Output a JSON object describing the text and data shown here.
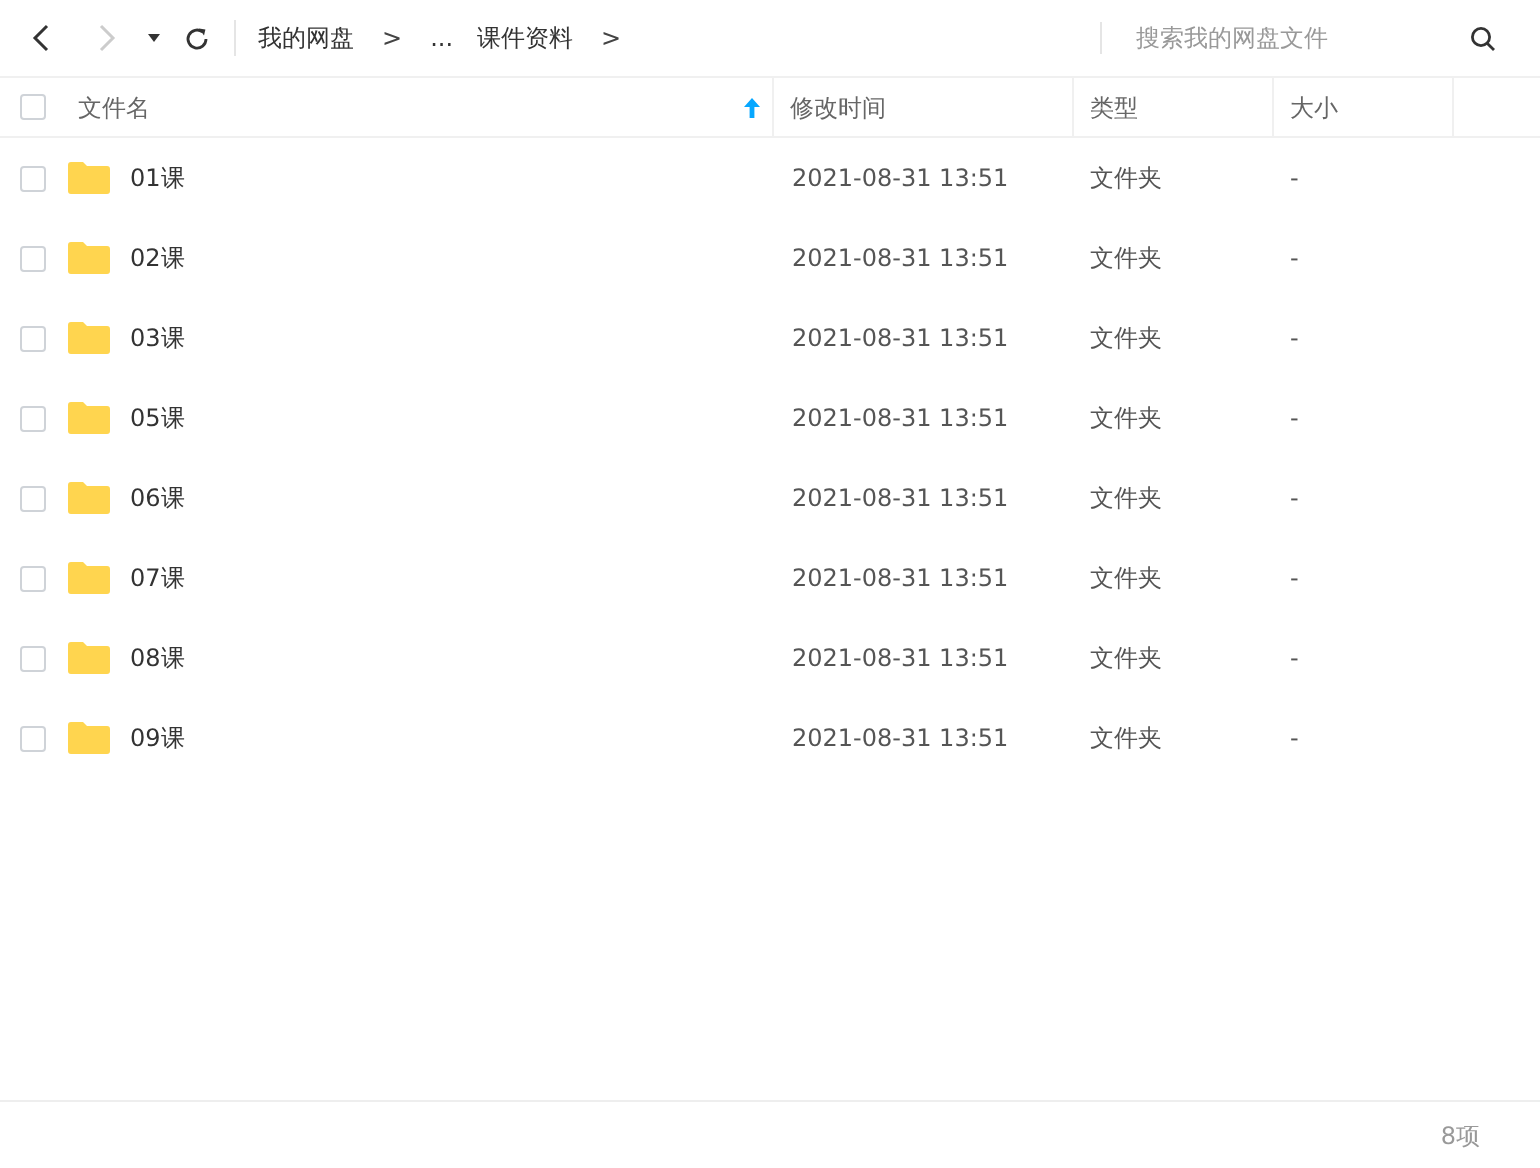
{
  "toolbar": {
    "back_disabled": false,
    "forward_disabled": true,
    "breadcrumbs": [
      {
        "kind": "crumb",
        "label": "我的网盘"
      },
      {
        "kind": "separator",
        "label": ">"
      },
      {
        "kind": "crumb",
        "label": "..."
      },
      {
        "kind": "crumb",
        "label": "课件资料"
      },
      {
        "kind": "separator",
        "label": ">"
      }
    ]
  },
  "search": {
    "placeholder": "搜索我的网盘文件"
  },
  "table": {
    "select_all": {
      "checked": false
    },
    "columns": [
      {
        "label": "文件名",
        "sorted": true
      },
      {
        "label": "修改时间",
        "sorted": false
      },
      {
        "label": "类型",
        "sorted": false
      },
      {
        "label": "大小",
        "sorted": false
      }
    ],
    "rows": [
      {
        "checked": false,
        "name": "01课",
        "modified": "2021-08-31 13:51",
        "type": "文件夹",
        "size": "-"
      },
      {
        "checked": false,
        "name": "02课",
        "modified": "2021-08-31 13:51",
        "type": "文件夹",
        "size": "-"
      },
      {
        "checked": false,
        "name": "03课",
        "modified": "2021-08-31 13:51",
        "type": "文件夹",
        "size": "-"
      },
      {
        "checked": false,
        "name": "05课",
        "modified": "2021-08-31 13:51",
        "type": "文件夹",
        "size": "-"
      },
      {
        "checked": false,
        "name": "06课",
        "modified": "2021-08-31 13:51",
        "type": "文件夹",
        "size": "-"
      },
      {
        "checked": false,
        "name": "07课",
        "modified": "2021-08-31 13:51",
        "type": "文件夹",
        "size": "-"
      },
      {
        "checked": false,
        "name": "08课",
        "modified": "2021-08-31 13:51",
        "type": "文件夹",
        "size": "-"
      },
      {
        "checked": false,
        "name": "09课",
        "modified": "2021-08-31 13:51",
        "type": "文件夹",
        "size": "-"
      }
    ]
  },
  "status_bar": {
    "count": "8项"
  }
}
